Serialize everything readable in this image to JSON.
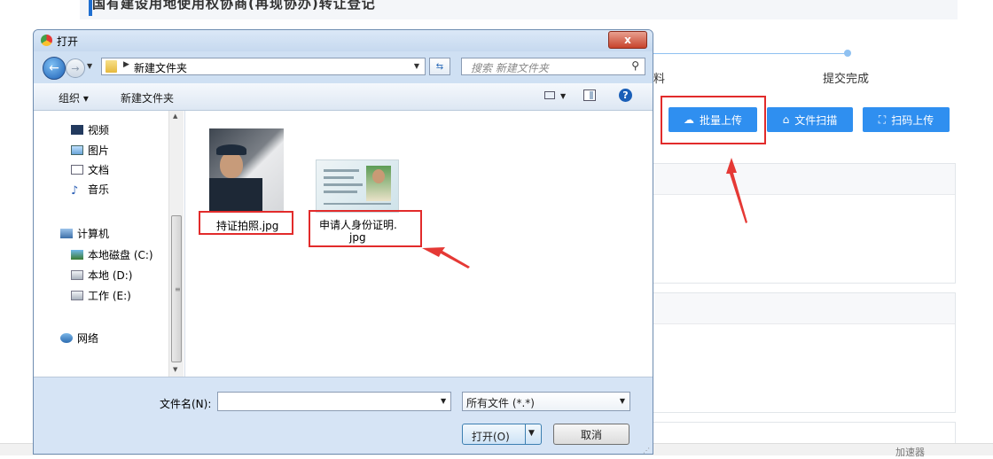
{
  "background_page": {
    "title": "国有建设用地使用权协商(再现协办)转让登记",
    "step_completed_label": "提交完成",
    "step_partial_label": "料",
    "buttons": [
      {
        "label": "批量上传",
        "icon": "cloud-upload-icon"
      },
      {
        "label": "文件扫描",
        "icon": "scan-icon"
      },
      {
        "label": "扫码上传",
        "icon": "qr-scan-icon"
      }
    ],
    "bottom_text": "加速器",
    "accent_color": "#2f8ff0",
    "highlight_color": "#e22b2b"
  },
  "dialog": {
    "title": "打开",
    "close_label": "x",
    "address": {
      "path": "新建文件夹"
    },
    "search": {
      "placeholder": "搜索 新建文件夹"
    },
    "toolbar": {
      "organize": "组织 ▾",
      "new_folder": "新建文件夹"
    },
    "nav_pane": [
      {
        "label": "视频",
        "icon": "video-library-icon"
      },
      {
        "label": "图片",
        "icon": "pictures-library-icon"
      },
      {
        "label": "文档",
        "icon": "documents-library-icon"
      },
      {
        "label": "音乐",
        "icon": "music-library-icon"
      },
      {
        "label": "计算机",
        "icon": "computer-icon"
      },
      {
        "label": "本地磁盘 (C:)",
        "icon": "drive-c-icon"
      },
      {
        "label": "本地 (D:)",
        "icon": "drive-icon"
      },
      {
        "label": "工作 (E:)",
        "icon": "drive-icon"
      },
      {
        "label": "网络",
        "icon": "network-icon"
      }
    ],
    "files": [
      {
        "name": "持证拍照.jpg"
      },
      {
        "name_line1": "申请人身份证明.",
        "name_line2": "jpg"
      }
    ],
    "footer": {
      "filename_label": "文件名(N):",
      "filename_value": "",
      "filetype_value": "所有文件 (*.*)",
      "open_label": "打开(O)",
      "cancel_label": "取消"
    }
  }
}
